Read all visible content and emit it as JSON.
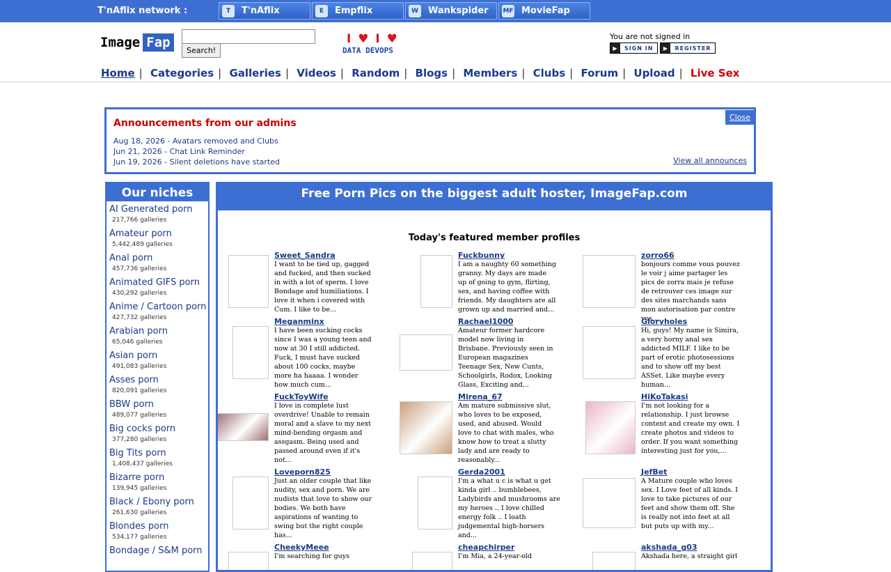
{
  "network": {
    "label": "T'nAflix network :",
    "sites": [
      {
        "name": "T'nAflix",
        "icon": "tnaflix-icon",
        "glyph": "T"
      },
      {
        "name": "Empflix",
        "icon": "empflix-icon",
        "glyph": "E"
      },
      {
        "name": "Wankspider",
        "icon": "wankspider-icon",
        "glyph": "W"
      },
      {
        "name": "MovieFap",
        "icon": "moviefap-icon",
        "glyph": "MF"
      }
    ]
  },
  "header": {
    "logo_part1": "Image",
    "logo_part2": "Fap",
    "search_value": "",
    "search_button": "Search!",
    "banner_hearts": "I ♥ I ♥",
    "banner_text": "DATA DEVOPS",
    "signed_status": "You are not signed in",
    "sign_in": "SIGN IN",
    "register": "REGISTER"
  },
  "nav": {
    "items": [
      "Home",
      "Categories",
      "Galleries",
      "Videos",
      "Random",
      "Blogs",
      "Members",
      "Clubs",
      "Forum",
      "Upload",
      "Live Sex"
    ]
  },
  "announcements": {
    "title": "Announcements from our admins",
    "items": [
      "Aug 18, 2026 - Avatars removed and Clubs",
      "Jun 21, 2026 - Chat Link Reminder",
      "Jun 19, 2026 - Silent deletions have started"
    ],
    "close": "Close",
    "view_all": "View all announces"
  },
  "niches": {
    "title": "Our niches",
    "items": [
      {
        "name": "AI Generated porn",
        "count": "217,766 galleries"
      },
      {
        "name": "Amateur porn",
        "count": "5,442,489 galleries"
      },
      {
        "name": "Anal porn",
        "count": "457,736 galleries"
      },
      {
        "name": "Animated GIFS porn",
        "count": "430,292 galleries"
      },
      {
        "name": "Anime / Cartoon porn",
        "count": "427,732 galleries"
      },
      {
        "name": "Arabian porn",
        "count": "65,046 galleries"
      },
      {
        "name": "Asian porn",
        "count": "491,083 galleries"
      },
      {
        "name": "Asses porn",
        "count": "820,091 galleries"
      },
      {
        "name": "BBW porn",
        "count": "489,077 galleries"
      },
      {
        "name": "Big cocks porn",
        "count": "377,280 galleries"
      },
      {
        "name": "Big Tits porn",
        "count": "1,408,437 galleries"
      },
      {
        "name": "Bizarre porn",
        "count": "139,945 galleries"
      },
      {
        "name": "Black / Ebony porn",
        "count": "261,630 galleries"
      },
      {
        "name": "Blondes porn",
        "count": "534,177 galleries"
      },
      {
        "name": "Bondage / S&M porn",
        "count": ""
      }
    ]
  },
  "main": {
    "title": "Free Porn Pics on the biggest adult hoster, ImageFap.com",
    "featured_title": "Today's featured member profiles",
    "profiles": [
      {
        "name": "Sweet_Sandra",
        "bio": "I want to be tied up, gagged and fucked, and then sucked in with a lot of sperm. I love Bondage and humiliations. I love it when i covered with Cum. I like to be..."
      },
      {
        "name": "Fuckbunny",
        "bio": "I am a naughty 60 something granny. My days are made up of going to gym, flirting, sex, and having coffee with friends. My daughters are all grown up and married and..."
      },
      {
        "name": "zorro66",
        "bio": "bonjours comme vous pouvez le voir j aime partager les pics de zorra mais je refuse de retrouver ces image sur des sites marchands sans mon autorisation par contre vos..."
      },
      {
        "name": "Meganminx",
        "bio": "I have been sucking cocks since I was a young teen and now at 30 I still addicted. Fuck, I must have sucked about 100 cocks, maybe more ha haaaa. I wonder how much cum..."
      },
      {
        "name": "Rachael1000",
        "bio": "Amateur former hardcore model now living in Brisbane. Previously seen in European magazines Teenage Sex, New Cunts, Schoolgirls, Rodox, Looking Glass, Exciting and..."
      },
      {
        "name": "Gloryholes",
        "bio": "Hi, guys! My name is Simira, a very horny anal sex addicted MILF. I like to be part of erotic photosessions and to show off my best ASSet. Like maybe every human..."
      },
      {
        "name": "FuckToyWife",
        "bio": "I love in complete lust overdrive! Unable to remain moral and a slave to my next mind-bending orgasm and assgasm. Being used and passed around even if it's not..."
      },
      {
        "name": "Mirena_67",
        "bio": "Am mature submissive slut, who loves to be exposed, used, and abused. Would love to chat with males, who know how to treat a slutty lady and are ready to reasonably..."
      },
      {
        "name": "HiKoTakasi",
        "bio": "I'm not looking for a relationship. I just browse content and create my own. I create photos and videos to order. If you want something interesting just for you,..."
      },
      {
        "name": "Loveporn825",
        "bio": "Just an older couple that like nudity, sex and porn. We are nudists that love to show our bodies. We both have aspirations of wanting to swing but the right couple has..."
      },
      {
        "name": "Gerda2001",
        "bio": "I'm a what u c is what u get kinda girl .. bumblebees, Ladybirds and mushrooms are my heroes .. I love chilled energy folk .. I loath judgemental high-horsers and..."
      },
      {
        "name": "JefBet",
        "bio": "A Mature couple who loves sex. I Love feet of all kinds. I love to take pictures of our feet and show them off. She is really not into feet at all but puts up with my..."
      },
      {
        "name": "CheekyMeee",
        "bio": "I'm searching for guys"
      },
      {
        "name": "cheapchirper",
        "bio": "I'm Mia, a 24-year-old"
      },
      {
        "name": "akshada_g03",
        "bio": "Akshada here, a straight girl"
      }
    ]
  },
  "colors": {
    "accent": "#3d6fd3",
    "link": "#1a3a8a",
    "alert": "#cc0000"
  }
}
